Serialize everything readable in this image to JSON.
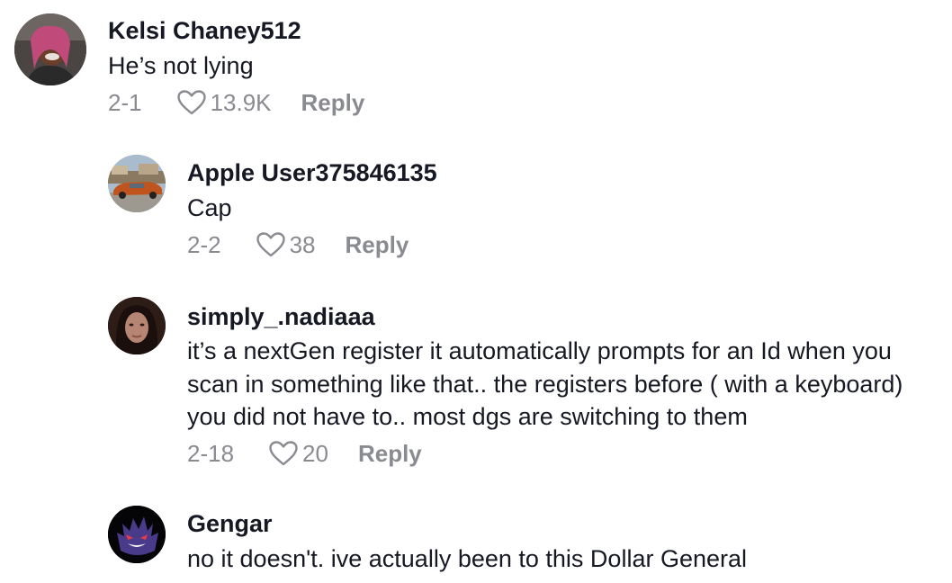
{
  "comments": [
    {
      "username": "Kelsi Chaney512",
      "text": "He’s not lying",
      "date": "2-1",
      "likes": "13.9K",
      "reply_label": "Reply",
      "avatar_icon": "user-avatar-photo"
    },
    {
      "username": "Apple User375846135",
      "text": "Cap",
      "date": "2-2",
      "likes": "38",
      "reply_label": "Reply",
      "avatar_icon": "car-photo-avatar"
    },
    {
      "username": "simply_.nadiaaa",
      "text": "it’s a nextGen register it automatically prompts for an Id when you scan in something like that.. the registers before ( with a keyboard) you did not have to.. most dgs are switching to them",
      "date": "2-18",
      "likes": "20",
      "reply_label": "Reply",
      "avatar_icon": "user-avatar-photo"
    },
    {
      "username": "Gengar",
      "text": "no it doesn't. ive actually been to this Dollar General",
      "avatar_icon": "gengar-avatar"
    }
  ],
  "colors": {
    "text": "#161823",
    "meta": "#8a8b91"
  }
}
